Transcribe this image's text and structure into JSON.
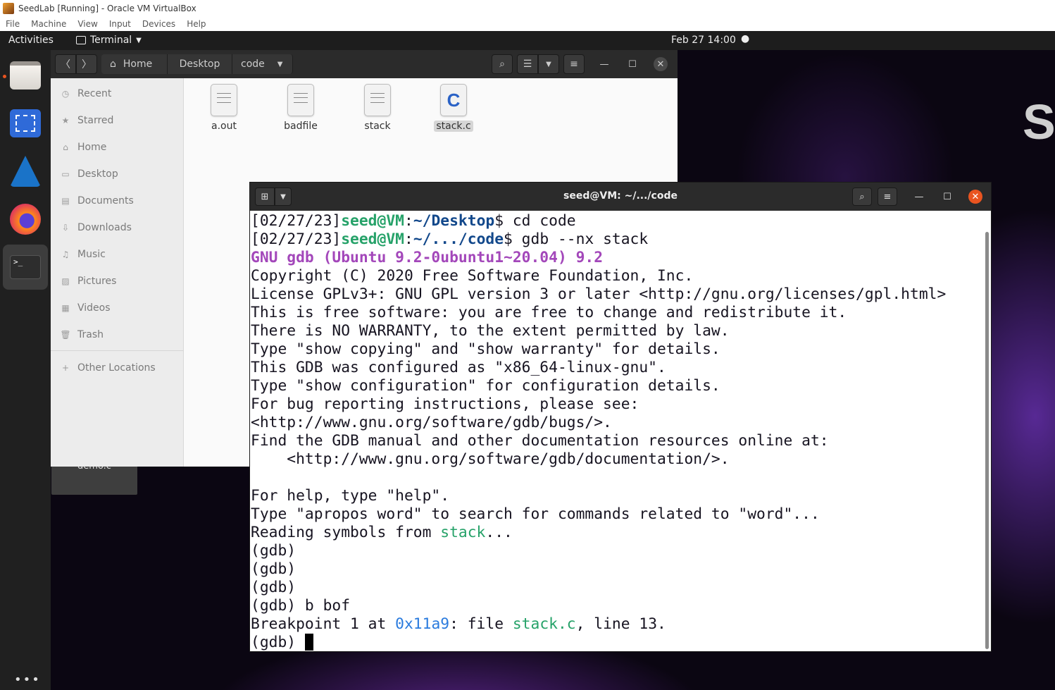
{
  "vbox": {
    "title": "SeedLab [Running] - Oracle VM VirtualBox",
    "menu": [
      "File",
      "Machine",
      "View",
      "Input",
      "Devices",
      "Help"
    ]
  },
  "topbar": {
    "activities": "Activities",
    "app_name": "Terminal",
    "clock": "Feb 27  14:00"
  },
  "desktop": {
    "demo_icon_label": "demo.c"
  },
  "dock": {
    "items": [
      "files",
      "screenshot",
      "wireshark",
      "firefox",
      "terminal"
    ]
  },
  "files": {
    "breadcrumb": [
      "Home",
      "Desktop",
      "code"
    ],
    "sidebar": [
      "Recent",
      "Starred",
      "Home",
      "Desktop",
      "Documents",
      "Downloads",
      "Music",
      "Pictures",
      "Videos",
      "Trash"
    ],
    "other_locations": "Other Locations",
    "items": [
      {
        "name": "a.out",
        "icon": "text-file-icon"
      },
      {
        "name": "badfile",
        "icon": "text-file-icon"
      },
      {
        "name": "stack",
        "icon": "text-file-icon"
      },
      {
        "name": "stack.c",
        "icon": "c-source-file-icon",
        "selected": true
      }
    ]
  },
  "terminal": {
    "title": "seed@VM: ~/.../code",
    "lines": {
      "l1": {
        "date": "[02/27/23]",
        "user": "seed@VM",
        "sep": ":",
        "path": "~/Desktop",
        "cmd": "$ cd code"
      },
      "l2": {
        "date": "[02/27/23]",
        "user": "seed@VM",
        "sep": ":",
        "path": "~/.../code",
        "cmd": "$ gdb --nx stack"
      },
      "l3": "GNU gdb (Ubuntu 9.2-0ubuntu1~20.04) 9.2",
      "l4": "Copyright (C) 2020 Free Software Foundation, Inc.",
      "l5": "License GPLv3+: GNU GPL version 3 or later <http://gnu.org/licenses/gpl.html>",
      "l6": "This is free software: you are free to change and redistribute it.",
      "l7": "There is NO WARRANTY, to the extent permitted by law.",
      "l8": "Type \"show copying\" and \"show warranty\" for details.",
      "l9": "This GDB was configured as \"x86_64-linux-gnu\".",
      "l10": "Type \"show configuration\" for configuration details.",
      "l11": "For bug reporting instructions, please see:",
      "l12": "<http://www.gnu.org/software/gdb/bugs/>.",
      "l13": "Find the GDB manual and other documentation resources online at:",
      "l14": "    <http://www.gnu.org/software/gdb/documentation/>.",
      "l15": "",
      "l16": "For help, type \"help\".",
      "l17": "Type \"apropos word\" to search for commands related to \"word\"...",
      "l18": {
        "pre": "Reading symbols from ",
        "file": "stack",
        "post": "..."
      },
      "l19": "(gdb)",
      "l20": "(gdb)",
      "l21": "(gdb)",
      "l22": "(gdb) b bof",
      "l23": {
        "pre": "Breakpoint 1 at ",
        "addr": "0x11a9",
        "mid": ": file ",
        "file": "stack.c",
        "post": ", line 13."
      },
      "l24": "(gdb) "
    }
  },
  "colors": {
    "prompt_user": "#26a269",
    "prompt_path": "#12488b",
    "gdb_banner": "#a347ba",
    "address": "#2a7bde",
    "close_button": "#e95420"
  }
}
